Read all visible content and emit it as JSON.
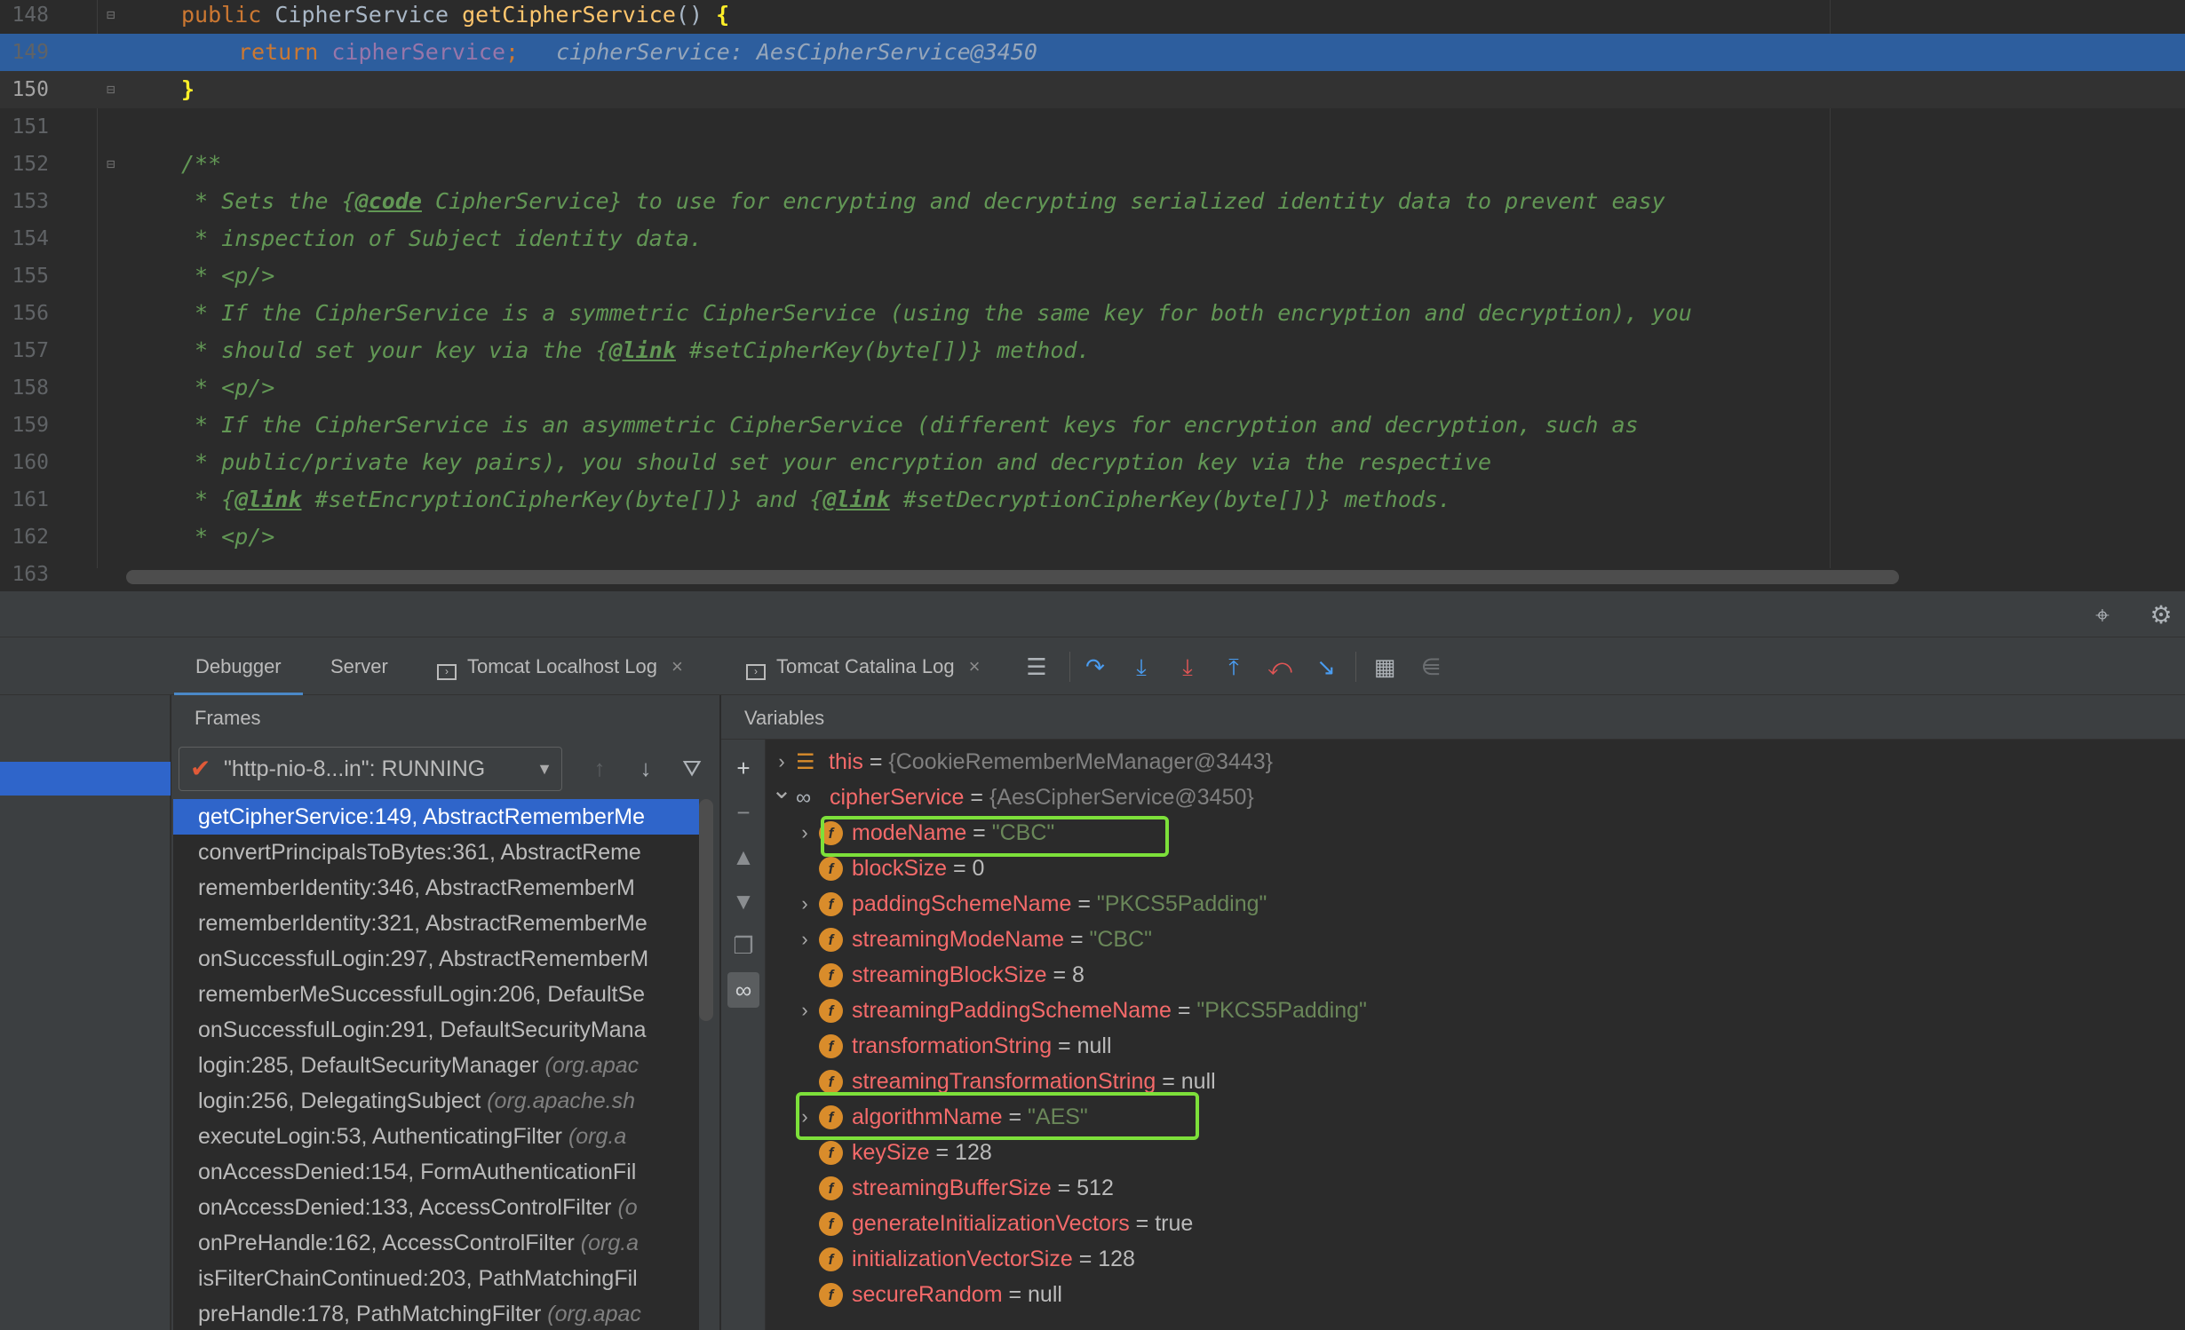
{
  "editor": {
    "lines": [
      {
        "num": "148",
        "tokens": [
          [
            "kw",
            "public "
          ],
          [
            "ty",
            "CipherService "
          ],
          [
            "fn",
            "getCipherService"
          ],
          [
            "ty",
            "() "
          ],
          [
            "brace-y",
            "{"
          ]
        ]
      },
      {
        "num": "149",
        "tokens": [
          [
            "kw",
            "return "
          ],
          [
            "fld",
            "cipherService"
          ],
          [
            "kw",
            ";"
          ]
        ],
        "hint": "cipherService: AesCipherService@3450"
      },
      {
        "num": "150",
        "tokens": [
          [
            "brace-y",
            "}"
          ]
        ]
      },
      {
        "num": "151",
        "tokens": []
      },
      {
        "num": "152",
        "tokens": [
          [
            "cmt",
            "/**"
          ]
        ]
      },
      {
        "num": "153",
        "tokens": [
          [
            "cmt",
            " * Sets the {"
          ],
          [
            "tag",
            "@code"
          ],
          [
            "cmt",
            " CipherService} to use for encrypting and decrypting serialized identity data to prevent easy"
          ]
        ]
      },
      {
        "num": "154",
        "tokens": [
          [
            "cmt",
            " * inspection of Subject identity data."
          ]
        ]
      },
      {
        "num": "155",
        "tokens": [
          [
            "cmt",
            " * <p/>"
          ]
        ]
      },
      {
        "num": "156",
        "tokens": [
          [
            "cmt",
            " * If the CipherService is a symmetric CipherService (using the same key for both encryption and decryption), you"
          ]
        ]
      },
      {
        "num": "157",
        "tokens": [
          [
            "cmt",
            " * should set your key via the {"
          ],
          [
            "tag",
            "@link"
          ],
          [
            "cmt",
            " #setCipherKey(byte[])} method."
          ]
        ]
      },
      {
        "num": "158",
        "tokens": [
          [
            "cmt",
            " * <p/>"
          ]
        ]
      },
      {
        "num": "159",
        "tokens": [
          [
            "cmt",
            " * If the CipherService is an asymmetric CipherService (different keys for encryption and decryption, such as"
          ]
        ]
      },
      {
        "num": "160",
        "tokens": [
          [
            "cmt",
            " * public/private key pairs), you should set your encryption and decryption key via the respective"
          ]
        ]
      },
      {
        "num": "161",
        "tokens": [
          [
            "cmt",
            " * {"
          ],
          [
            "tag",
            "@link"
          ],
          [
            "cmt",
            " #setEncryptionCipherKey(byte[])} and {"
          ],
          [
            "tag",
            "@link"
          ],
          [
            "cmt",
            " #setDecryptionCipherKey(byte[])} methods."
          ]
        ]
      },
      {
        "num": "162",
        "tokens": [
          [
            "cmt",
            " * <p/>"
          ]
        ]
      },
      {
        "num": "163",
        "tokens": []
      }
    ]
  },
  "tabs": {
    "debugger": "Debugger",
    "server": "Server",
    "tomcat_localhost_log": "Tomcat Localhost Log",
    "tomcat_catalina_log": "Tomcat Catalina Log",
    "close_glyph": "×"
  },
  "frames": {
    "title": "Frames",
    "thread": "\"http-nio-8...in\": RUNNING",
    "rows": [
      {
        "method": "getCipherService:149, AbstractRememberMe",
        "pkg": ""
      },
      {
        "method": "convertPrincipalsToBytes:361, AbstractReme",
        "pkg": ""
      },
      {
        "method": "rememberIdentity:346, AbstractRememberM",
        "pkg": ""
      },
      {
        "method": "rememberIdentity:321, AbstractRememberMe",
        "pkg": ""
      },
      {
        "method": "onSuccessfulLogin:297, AbstractRememberM",
        "pkg": ""
      },
      {
        "method": "rememberMeSuccessfulLogin:206, DefaultSe",
        "pkg": ""
      },
      {
        "method": "onSuccessfulLogin:291, DefaultSecurityMana",
        "pkg": ""
      },
      {
        "method": "login:285, DefaultSecurityManager ",
        "pkg": "(org.apac"
      },
      {
        "method": "login:256, DelegatingSubject ",
        "pkg": "(org.apache.sh"
      },
      {
        "method": "executeLogin:53, AuthenticatingFilter ",
        "pkg": "(org.a"
      },
      {
        "method": "onAccessDenied:154, FormAuthenticationFil",
        "pkg": ""
      },
      {
        "method": "onAccessDenied:133, AccessControlFilter ",
        "pkg": "(o"
      },
      {
        "method": "onPreHandle:162, AccessControlFilter ",
        "pkg": "(org.a"
      },
      {
        "method": "isFilterChainContinued:203, PathMatchingFil",
        "pkg": ""
      },
      {
        "method": "preHandle:178, PathMatchingFilter ",
        "pkg": "(org.apac"
      }
    ]
  },
  "variables": {
    "title": "Variables",
    "rows": [
      {
        "name": "this",
        "eq": " = ",
        "value": "{CookieRememberMeManager@3443}",
        "vtype": "obj",
        "icon": "list",
        "arrow": "right",
        "indent": 0
      },
      {
        "name": "cipherService",
        "eq": " = ",
        "value": "{AesCipherService@3450}",
        "vtype": "obj",
        "icon": "watch",
        "arrow": "down",
        "indent": 0
      },
      {
        "name": "modeName",
        "eq": " = ",
        "value": "\"CBC\"",
        "vtype": "str",
        "icon": "f",
        "arrow": "right",
        "indent": 1
      },
      {
        "name": "blockSize",
        "eq": " = ",
        "value": "0",
        "vtype": "num",
        "icon": "f",
        "arrow": "",
        "indent": 1
      },
      {
        "name": "paddingSchemeName",
        "eq": " = ",
        "value": "\"PKCS5Padding\"",
        "vtype": "str",
        "icon": "f",
        "arrow": "right",
        "indent": 1
      },
      {
        "name": "streamingModeName",
        "eq": " = ",
        "value": "\"CBC\"",
        "vtype": "str",
        "icon": "f",
        "arrow": "right",
        "indent": 1
      },
      {
        "name": "streamingBlockSize",
        "eq": " = ",
        "value": "8",
        "vtype": "num",
        "icon": "f",
        "arrow": "",
        "indent": 1
      },
      {
        "name": "streamingPaddingSchemeName",
        "eq": " = ",
        "value": "\"PKCS5Padding\"",
        "vtype": "str",
        "icon": "f",
        "arrow": "right",
        "indent": 1
      },
      {
        "name": "transformationString",
        "eq": " = ",
        "value": "null",
        "vtype": "num",
        "icon": "f",
        "arrow": "",
        "indent": 1
      },
      {
        "name": "streamingTransformationString",
        "eq": " = ",
        "value": "null",
        "vtype": "num",
        "icon": "f",
        "arrow": "",
        "indent": 1
      },
      {
        "name": "algorithmName",
        "eq": " = ",
        "value": "\"AES\"",
        "vtype": "str",
        "icon": "f",
        "arrow": "right",
        "indent": 1
      },
      {
        "name": "keySize",
        "eq": " = ",
        "value": "128",
        "vtype": "num",
        "icon": "f",
        "arrow": "",
        "indent": 1
      },
      {
        "name": "streamingBufferSize",
        "eq": " = ",
        "value": "512",
        "vtype": "num",
        "icon": "f",
        "arrow": "",
        "indent": 1
      },
      {
        "name": "generateInitializationVectors",
        "eq": " = ",
        "value": "true",
        "vtype": "num",
        "icon": "f",
        "arrow": "",
        "indent": 1
      },
      {
        "name": "initializationVectorSize",
        "eq": " = ",
        "value": "128",
        "vtype": "num",
        "icon": "f",
        "arrow": "",
        "indent": 1
      },
      {
        "name": "secureRandom",
        "eq": " = ",
        "value": "null",
        "vtype": "num",
        "icon": "f",
        "arrow": "",
        "indent": 1
      }
    ]
  },
  "colors": {
    "highlight_box": "#7de03a",
    "selection": "#2f65ca",
    "execution_line": "#2d5e9e"
  }
}
